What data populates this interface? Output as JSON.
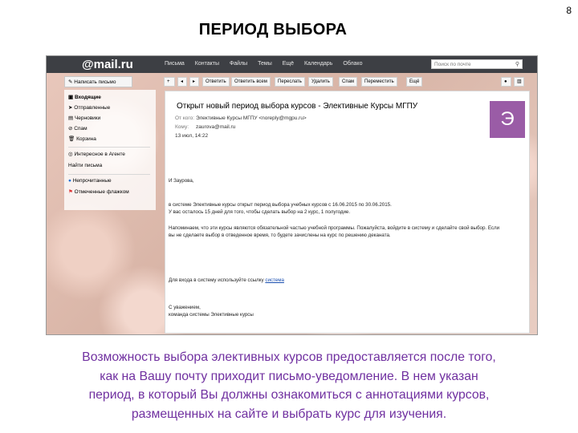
{
  "slide": {
    "number": "8",
    "title": "ПЕРИОД ВЫБОРА",
    "caption_lines": [
      "Возможность выбора элективных курсов предоставляется после того,",
      "как на Вашу почту приходит письмо-уведомление. В нем указан",
      "период, в который Вы должны ознакомиться с аннотациями курсов,",
      "размещенных на сайте и выбрать курс для изучения."
    ],
    "caption_color": "#7030a0"
  },
  "mail": {
    "logo": "@mail.ru",
    "nav": [
      "Письма",
      "Контакты",
      "Файлы",
      "Темы",
      "Ещё",
      "Календарь",
      "Облако"
    ],
    "search_placeholder": "Поиск по почте",
    "write_label": "Написать письмо",
    "toolbar": [
      "Ответить",
      "Ответить всем",
      "Переслать",
      "Удалить",
      "Спам",
      "Переместить",
      "Ещё"
    ],
    "folders": [
      "Входящие",
      "Отправленные",
      "Черновики",
      "Спам",
      "Корзина",
      "Интересное в Агенте",
      "Найти письма",
      "Непрочитанные",
      "Отмеченные флажком"
    ],
    "accent_color": "#9a5ca6"
  },
  "email": {
    "subject": "Открыт новый период выбора курсов - Элективные Курсы МГПУ",
    "from_label": "От кого:",
    "from_value": "Элективные Курсы МГПУ <noreply@mgpu.ru>",
    "to_label": "Кому:",
    "to_value": "zaurova@mail.ru",
    "date": "13 июл, 14:22",
    "avatar_letter": "Э",
    "greeting": "И Заурова,",
    "p1_l1": "в системе Элективные курсы открыт период выбора учебных курсов с 16.06.2015 по 30.06.2015.",
    "p1_l2": "У вас осталось 15 дней для того, чтобы сделать выбор на 2 курс, 1 полугодие.",
    "p2_l1": "Напоминаем, что эти курсы являются обязательной частью учебной программы. Пожалуйста, войдите в систему и сделайте свой выбор. Если",
    "p2_l2": "вы не сделаете выбор в отведенное время, то будете зачислены на курс по решению деканата.",
    "p3_text": "Для входа в систему используйте ссылку",
    "p3_link": "система",
    "sign_l1": "С уважением,",
    "sign_l2": "команда системы Элективные курсы"
  }
}
